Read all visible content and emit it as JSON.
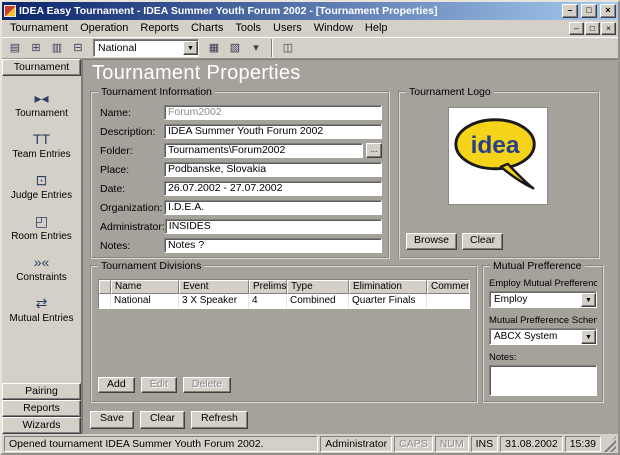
{
  "window": {
    "title": "IDEA Easy Tournament - IDEA Summer Youth Forum 2002 - [Tournament Properties]",
    "controls": {
      "minimize": "–",
      "maximize": "□",
      "close": "×"
    }
  },
  "menu": [
    "Tournament",
    "Operation",
    "Reports",
    "Charts",
    "Tools",
    "Users",
    "Window",
    "Help"
  ],
  "toolbar": {
    "division_combo": "National",
    "buttons": [
      "▤",
      "⊞",
      "▥",
      "⊟",
      "▦",
      "▧",
      "◫"
    ],
    "dropdown_glyph": "▾"
  },
  "icons": {
    "dropdown": "▼"
  },
  "sidebar": {
    "active_section": "Tournament",
    "items": [
      {
        "label": "Tournament",
        "glyph": "▸◂"
      },
      {
        "label": "Team Entries",
        "glyph": "TT"
      },
      {
        "label": "Judge Entries",
        "glyph": "⊡"
      },
      {
        "label": "Room Entries",
        "glyph": "◰"
      },
      {
        "label": "Constraints",
        "glyph": "»«"
      },
      {
        "label": "Mutual Entries",
        "glyph": "⇄"
      }
    ],
    "bottom_sections": [
      "Pairing",
      "Reports",
      "Wizards"
    ]
  },
  "page": {
    "title": "Tournament Properties"
  },
  "tournament_information": {
    "legend": "Tournament Information",
    "browse_label": "...",
    "fields": [
      {
        "label": "Name:",
        "value": "Forum2002"
      },
      {
        "label": "Description:",
        "value": "IDEA Summer Youth Forum 2002"
      },
      {
        "label": "Folder:",
        "value": "Tournaments\\Forum2002"
      },
      {
        "label": "Place:",
        "value": "Podbanske, Slovakia"
      },
      {
        "label": "Date:",
        "value": "26.07.2002 - 27.07.2002"
      },
      {
        "label": "Organization:",
        "value": "I.D.E.A."
      },
      {
        "label": "Administrator:",
        "value": "INSIDES"
      },
      {
        "label": "Notes:",
        "value": "Notes ?"
      }
    ]
  },
  "tournament_logo": {
    "legend": "Tournament Logo",
    "logo_text": "idea",
    "browse": "Browse",
    "clear": "Clear"
  },
  "divisions": {
    "legend": "Tournament Divisions",
    "columns": [
      "Name",
      "Event",
      "Prelims",
      "Type",
      "Elimination",
      "Comment"
    ],
    "rows": [
      [
        "National",
        "3 X Speaker",
        "4",
        "Combined",
        "Quarter Finals",
        ""
      ]
    ],
    "add": "Add",
    "edit": "Edit",
    "delete": "Delete"
  },
  "mutual_preference": {
    "legend": "Mutual Prefference",
    "employ_label": "Employ Mutual Prefference:",
    "employ_value": "Employ",
    "scheme_label": "Mutual Prefference Scheme:",
    "scheme_value": "ABCX System",
    "notes_label": "Notes:",
    "notes_value": ""
  },
  "actions": {
    "save": "Save",
    "clear": "Clear",
    "refresh": "Refresh"
  },
  "statusbar": {
    "message": "Opened tournament IDEA Summer Youth Forum 2002.",
    "user": "Administrator",
    "caps": "CAPS",
    "num": "NUM",
    "ins": "INS",
    "date": "31.08.2002",
    "time": "15:39"
  },
  "colors": {
    "titlebar_gradient_start": "#0a246a",
    "titlebar_gradient_end": "#a6caf0",
    "chrome": "#d4d0c8",
    "workspace": "#a5a29b",
    "logo_yellow": "#f5d318",
    "logo_blue": "#27408b"
  }
}
